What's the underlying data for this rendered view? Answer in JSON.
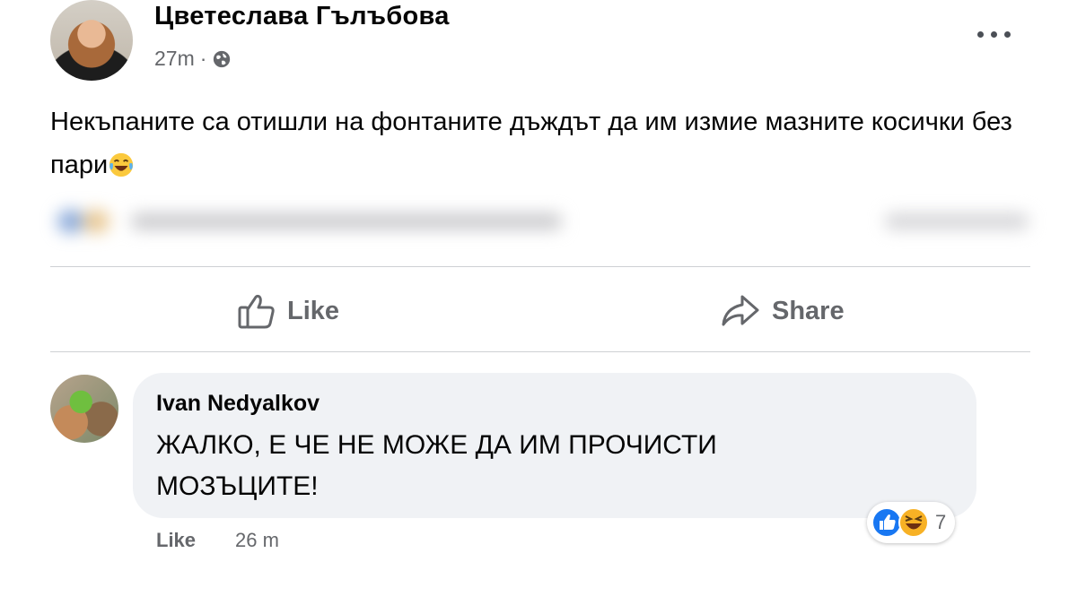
{
  "post": {
    "author": "Цветеслава Гълъбова",
    "time": "27m",
    "separator": "·",
    "privacy_icon": "globe-icon",
    "text": "Некъпаните са отишли на фонтаните дъждът да им измие мазните косички без пари",
    "text_emoji": "laughing-tears-emoji"
  },
  "actions": {
    "like_label": "Like",
    "share_label": "Share"
  },
  "comment": {
    "author": "Ivan Nedyalkov",
    "text": "ЖАЛКО, Е ЧЕ НЕ МОЖЕ ДА ИМ ПРОЧИСТИ МОЗЪЦИТЕ!",
    "like_label": "Like",
    "time": "26 m",
    "reaction_count": "7",
    "reaction_icons": [
      "like-reaction-icon",
      "haha-reaction-icon"
    ]
  },
  "colors": {
    "secondary_text": "#65676b",
    "bubble_bg": "#f0f2f5",
    "like_blue": "#1877f2"
  }
}
